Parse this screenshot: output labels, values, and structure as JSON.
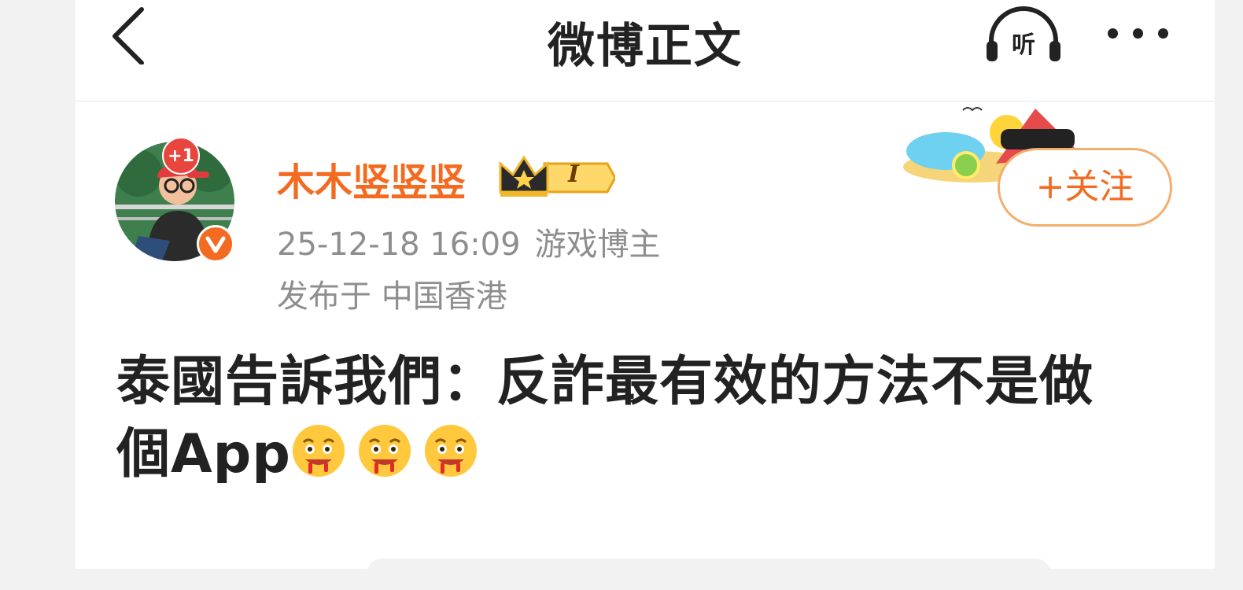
{
  "header": {
    "title": "微博正文",
    "back_icon": "chevron-left-icon",
    "listen_label": "听",
    "listen_icon": "headphones-icon",
    "more_icon": "more-dots-icon"
  },
  "author": {
    "name": "木木竖竖竖",
    "name_color": "#f26b21",
    "plus_badge": "+1",
    "verified_badge": "V",
    "vip_level": "I",
    "timestamp": "25-12-18 16:09",
    "tag": "游戏博主",
    "location": "发布于 中国香港"
  },
  "follow": {
    "label": "+关注",
    "accent": "#f26b21"
  },
  "post": {
    "line1": "泰國告訴我們：反詐最有效的方法不是做",
    "line2": "個App",
    "emoji_icon": "drooling-face-emoji"
  }
}
